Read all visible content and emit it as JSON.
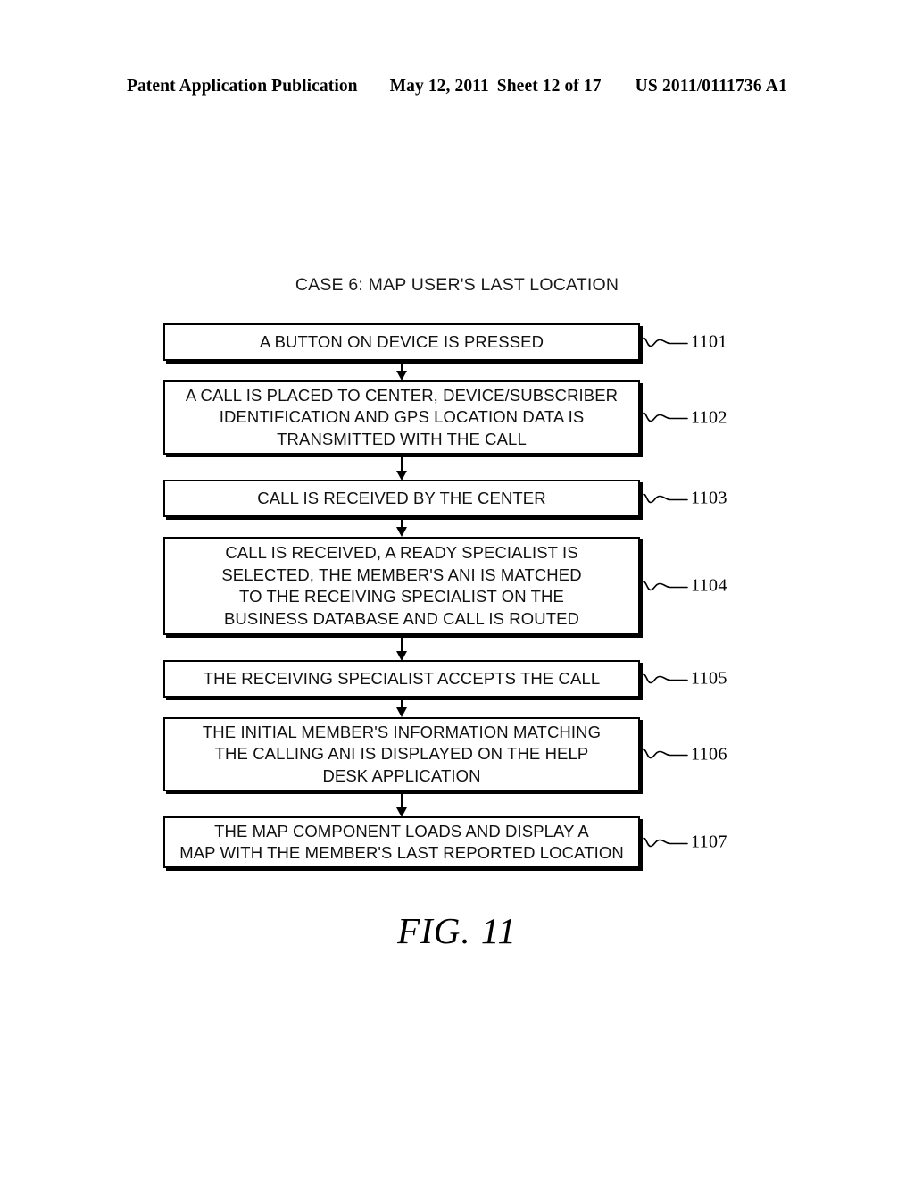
{
  "header": {
    "publication": "Patent Application Publication",
    "date": "May 12, 2011",
    "sheet": "Sheet 12 of 17",
    "document_number": "US 2011/0111736 A1"
  },
  "figure": {
    "title": "CASE 6: MAP USER'S LAST LOCATION",
    "caption": "FIG. 11"
  },
  "flowchart": {
    "type": "flowchart",
    "orientation": "vertical",
    "connector": "downward-arrow",
    "nodes": [
      {
        "ref": "1101",
        "lines": [
          "A BUTTON ON DEVICE IS PRESSED"
        ]
      },
      {
        "ref": "1102",
        "lines": [
          "A CALL IS PLACED TO CENTER, DEVICE/SUBSCRIBER",
          "IDENTIFICATION AND GPS LOCATION DATA IS",
          "TRANSMITTED WITH THE CALL"
        ]
      },
      {
        "ref": "1103",
        "lines": [
          "CALL IS RECEIVED BY THE CENTER"
        ]
      },
      {
        "ref": "1104",
        "lines": [
          "CALL IS RECEIVED, A READY SPECIALIST IS",
          "SELECTED, THE MEMBER'S ANI IS MATCHED",
          "TO THE RECEIVING SPECIALIST ON THE",
          "BUSINESS DATABASE AND CALL IS ROUTED"
        ]
      },
      {
        "ref": "1105",
        "lines": [
          "THE RECEIVING SPECIALIST ACCEPTS THE CALL"
        ]
      },
      {
        "ref": "1106",
        "lines": [
          "THE INITIAL MEMBER'S INFORMATION MATCHING",
          "THE CALLING ANI IS DISPLAYED ON THE HELP",
          "DESK APPLICATION"
        ]
      },
      {
        "ref": "1107",
        "lines": [
          "THE MAP COMPONENT LOADS AND DISPLAY A",
          "MAP WITH THE MEMBER'S LAST REPORTED LOCATION"
        ]
      }
    ]
  }
}
